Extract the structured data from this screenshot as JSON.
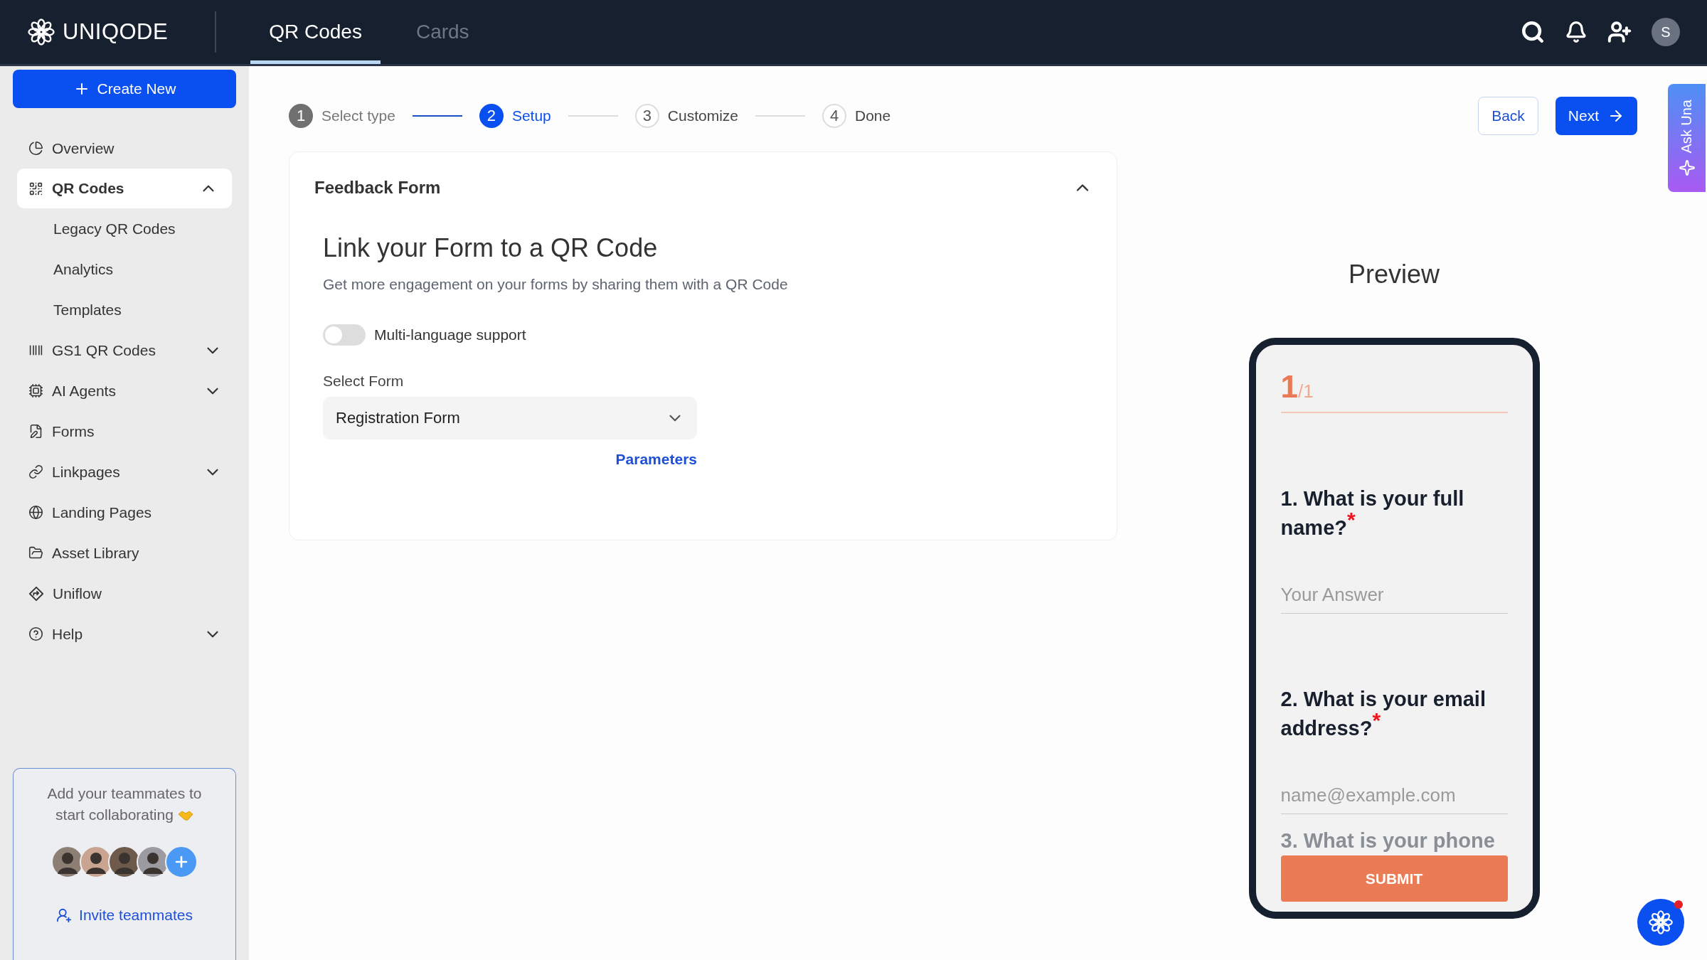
{
  "header": {
    "logo": "UNIQODE",
    "tabs": [
      {
        "label": "QR Codes",
        "selected": true
      },
      {
        "label": "Cards",
        "selected": false
      }
    ],
    "avatar_initial": "S"
  },
  "sidebar": {
    "create_button": "Create New",
    "items": [
      {
        "label": "Overview",
        "selected": false
      },
      {
        "label": "QR Codes",
        "selected": true,
        "expanded": true,
        "children": [
          {
            "label": "Legacy QR Codes",
            "selected": false
          },
          {
            "label": "Analytics",
            "selected": false
          },
          {
            "label": "Templates",
            "selected": false
          }
        ]
      },
      {
        "label": "GS1 QR Codes",
        "selected": false,
        "expanded": false
      },
      {
        "label": "AI Agents",
        "selected": false,
        "expanded": false
      },
      {
        "label": "Forms",
        "selected": false
      },
      {
        "label": "Linkpages",
        "selected": false,
        "expanded": false
      },
      {
        "label": "Landing Pages",
        "selected": false
      },
      {
        "label": "Asset Library",
        "selected": false
      },
      {
        "label": "Uniflow",
        "selected": false
      },
      {
        "label": "Help",
        "selected": false,
        "expanded": false
      }
    ],
    "invite": {
      "message": "Add your teammates to start collaborating",
      "link": "Invite teammates"
    }
  },
  "steps": [
    {
      "number": "1",
      "label": "Select type",
      "completed": true,
      "selected": false
    },
    {
      "number": "2",
      "label": "Setup",
      "completed": false,
      "selected": true
    },
    {
      "number": "3",
      "label": "Customize",
      "completed": false,
      "selected": false
    },
    {
      "number": "4",
      "label": "Done",
      "completed": false,
      "selected": false
    }
  ],
  "actions": {
    "back": "Back",
    "next": "Next"
  },
  "ask_una": "Ask Una",
  "form_card": {
    "title": "Feedback Form",
    "expanded": true,
    "heading": "Link your Form to a QR Code",
    "subtitle": "Get more engagement on your forms by sharing them with a QR Code",
    "toggle": {
      "label": "Multi-language support",
      "on": false
    },
    "select": {
      "label": "Select Form",
      "value": "Registration Form"
    },
    "link": "Parameters"
  },
  "preview": {
    "title": "Preview",
    "page": "1",
    "page_total": "/1",
    "questions": [
      {
        "text": "1. What is your full name?",
        "mark": "*",
        "placeholder": "Your Answer"
      },
      {
        "text": "2. What is your email address?",
        "mark": "*",
        "placeholder": "name@example.com"
      }
    ],
    "faded_question": "3. What is your phone",
    "submit": "SUBMIT"
  }
}
